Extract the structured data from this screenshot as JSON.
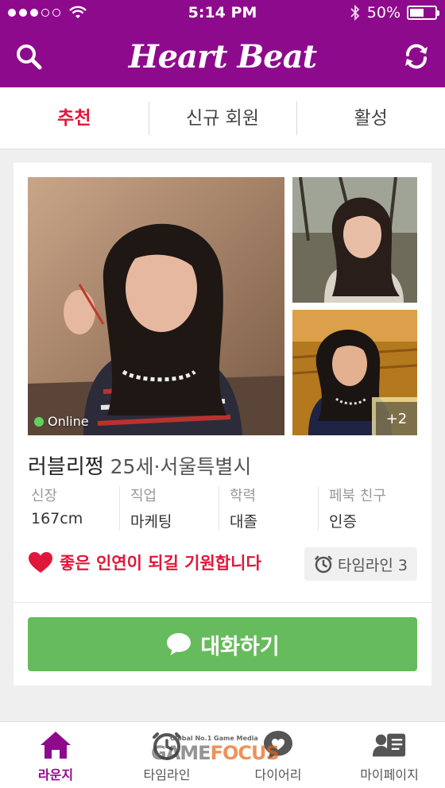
{
  "status_bar": {
    "time": "5:14 PM",
    "battery_text": "50%",
    "battery_level": 0.5,
    "signal_bars_filled": 3,
    "signal_bars_total": 5
  },
  "header": {
    "app_title": "Heart Beat",
    "left_icon": "search-icon",
    "right_icon": "refresh-icon",
    "color": "#8e0a8c"
  },
  "tabs": [
    {
      "label": "추천",
      "active": true
    },
    {
      "label": "신규 회원",
      "active": false
    },
    {
      "label": "활성",
      "active": false
    }
  ],
  "profile": {
    "online_label": "Online",
    "more_photos": "+2",
    "name": "러블리쩡",
    "meta": "25세·서울특별시",
    "info": [
      {
        "label": "신장",
        "value": "167cm"
      },
      {
        "label": "직업",
        "value": "마케팅"
      },
      {
        "label": "학력",
        "value": "대졸"
      },
      {
        "label": "페북 친구",
        "value": "인증"
      }
    ],
    "wish_text": "좋은 인연이 되길 기원합니다",
    "timeline_button": "타임라인 3",
    "chat_button": "대화하기"
  },
  "bottom_nav": [
    {
      "label": "라운지",
      "icon": "home-icon",
      "active": true
    },
    {
      "label": "타임라인",
      "icon": "clock-icon",
      "active": false
    },
    {
      "label": "다이어리",
      "icon": "heart-bubble-icon",
      "active": false
    },
    {
      "label": "마이페이지",
      "icon": "profile-card-icon",
      "active": false
    }
  ],
  "watermark": {
    "tagline": "Global No.1 Game Media",
    "part1": "GAME",
    "part2": "FOCUS"
  },
  "colors": {
    "brand": "#8e0a8c",
    "accent_red": "#e0173a",
    "chat_green": "#66bb5c",
    "online_green": "#5fd35f"
  }
}
